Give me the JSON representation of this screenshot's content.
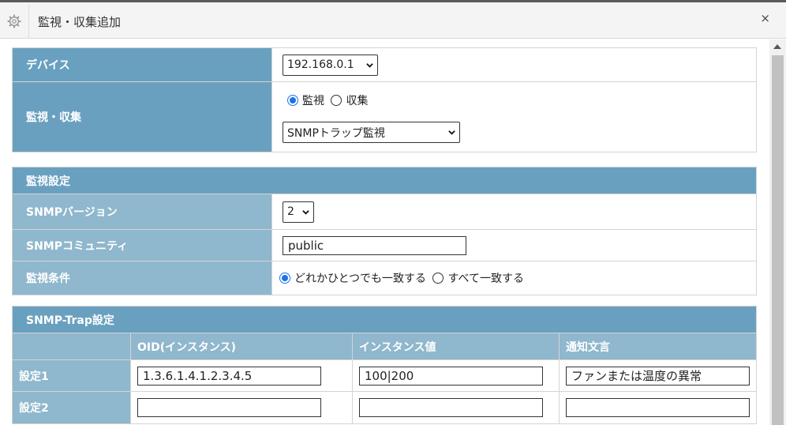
{
  "dialog": {
    "title": "監視・収集追加",
    "close_label": "×"
  },
  "device": {
    "label": "デバイス",
    "value": "192.168.0.1"
  },
  "monitor_collect": {
    "label": "監視・収集",
    "options": [
      "監視",
      "収集"
    ],
    "selected": "監視",
    "type_value": "SNMPトラップ監視"
  },
  "monitor_settings": {
    "header": "監視設定",
    "snmp_version": {
      "label": "SNMPバージョン",
      "value": "2"
    },
    "snmp_community": {
      "label": "SNMPコミュニティ",
      "value": "public"
    },
    "condition": {
      "label": "監視条件",
      "options": [
        "どれかひとつでも一致する",
        "すべて一致する"
      ],
      "selected": "どれかひとつでも一致する"
    }
  },
  "trap_settings": {
    "header": "SNMP-Trap設定",
    "columns": [
      "",
      "OID(インスタンス)",
      "インスタンス値",
      "通知文言"
    ],
    "rows": [
      {
        "label": "設定1",
        "oid": "1.3.6.1.4.1.2.3.4.5",
        "instance": "100|200",
        "message": "ファンまたは温度の異常"
      },
      {
        "label": "設定2",
        "oid": "",
        "instance": "",
        "message": ""
      }
    ]
  }
}
